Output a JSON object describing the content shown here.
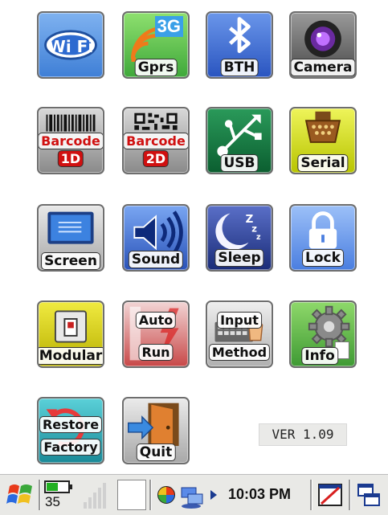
{
  "tiles": [
    {
      "label": "Wi Fi",
      "icon": "wifi-icon"
    },
    {
      "label": "Gprs",
      "badge": "3G",
      "icon": "gprs-signal-icon"
    },
    {
      "label": "BTH",
      "icon": "bluetooth-icon"
    },
    {
      "label": "Camera",
      "icon": "camera-lens-icon"
    },
    {
      "label": "Barcode",
      "label2": "1D",
      "icon": "barcode-1d-icon"
    },
    {
      "label": "Barcode",
      "label2": "2D",
      "icon": "barcode-2d-icon"
    },
    {
      "label": "USB",
      "icon": "usb-icon"
    },
    {
      "label": "Serial",
      "icon": "serial-port-icon"
    },
    {
      "label": "Screen",
      "icon": "screen-icon"
    },
    {
      "label": "Sound",
      "icon": "speaker-icon"
    },
    {
      "label": "Sleep",
      "icon": "moon-sleep-icon"
    },
    {
      "label": "Lock",
      "icon": "padlock-icon"
    },
    {
      "label": "Modular",
      "icon": "module-switch-icon"
    },
    {
      "label": "Auto",
      "label2": "Run",
      "icon": "auto-run-icon"
    },
    {
      "label": "Input",
      "label2": "Method",
      "icon": "input-method-icon"
    },
    {
      "label": "Info",
      "icon": "gear-info-icon"
    },
    {
      "label": "Restore",
      "label2": "Factory",
      "icon": "restore-icon"
    },
    {
      "label": "Quit",
      "icon": "exit-door-icon"
    }
  ],
  "version": "VER 1.09",
  "taskbar": {
    "battery_level": "35",
    "time": "10:03 PM",
    "icons": [
      "windows-start-icon",
      "battery-icon",
      "signal-bars-icon",
      "input-panel-icon",
      "color-wheel-icon",
      "network-icon",
      "arrow-right-icon",
      "pen-input-icon",
      "windows-switch-icon"
    ]
  },
  "colors": {
    "wifi": "#3f7fd6",
    "gprs": "#58b84a",
    "bth": "#2f5fc7",
    "camera": "#5a5a5a",
    "barcode": "#8a8a8a",
    "usb": "#0e7a40",
    "serial": "#c8d400",
    "screen": "#b5b5b5",
    "sound": "#2a52b8",
    "sleep": "#233a8a",
    "lock": "#5f8fe8",
    "modular": "#d8d000",
    "autorun": "#d85a5a",
    "input": "#c4c4c4",
    "info": "#5fb04a",
    "restore": "#22a0a8",
    "quit": "#c8c8c8"
  }
}
